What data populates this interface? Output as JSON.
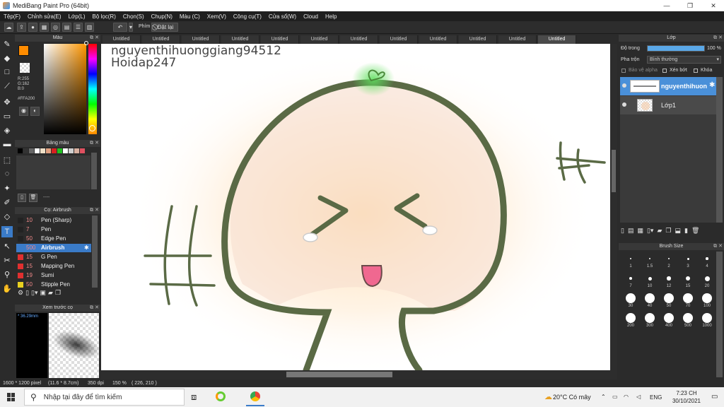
{
  "window": {
    "title": "MediBang Paint Pro (64bit)",
    "controls": [
      "—",
      "❐",
      "✕"
    ]
  },
  "menu": [
    "Tệp(F)",
    "Chỉnh sửa(E)",
    "Lớp(L)",
    "Bộ lọc(R)",
    "Chọn(S)",
    "Chụp(N)",
    "Màu (C)",
    "Xem(V)",
    "Công cụ(T)",
    "Cửa sổ(W)",
    "Cloud",
    "Help"
  ],
  "toolbar": {
    "key_label": "Phím",
    "reset_label": "Đặt lại"
  },
  "tabs": [
    "Untitled",
    "Untitled",
    "Untitled",
    "Untitled",
    "Untitled",
    "Untitled",
    "Untitled",
    "Untitled",
    "Untitled",
    "Untitled",
    "Untitled",
    "Untitled"
  ],
  "color_panel": {
    "title": "Màu",
    "foreground": "#FF8C00",
    "r": "R:255",
    "g": "G:162",
    "b": "B:0",
    "hex": "#FFA200"
  },
  "palette_panel": {
    "title": "Bảng màu",
    "colors": [
      "#000000",
      "#333333",
      "#666666",
      "#ffffff",
      "#f0e0c8",
      "#e0a080",
      "#d82020",
      "#20c020",
      "#ffffff",
      "#d0d0d0",
      "#d8b0a0",
      "#e05060"
    ],
    "name": "----"
  },
  "brush_panel": {
    "title": "Cọ: Airbrush",
    "items": [
      {
        "size": "10",
        "name": "Pen (Sharp)",
        "color": "#222222"
      },
      {
        "size": "7",
        "name": "Pen",
        "color": "#222222"
      },
      {
        "size": "50",
        "name": "Edge Pen",
        "color": "#222222"
      },
      {
        "size": "500",
        "name": "Airbrush",
        "color": "#3a7bc8"
      },
      {
        "size": "15",
        "name": "G Pen",
        "color": "#e03030"
      },
      {
        "size": "15",
        "name": "Mapping Pen",
        "color": "#e03030"
      },
      {
        "size": "19",
        "name": "Sumi",
        "color": "#e03030"
      },
      {
        "size": "50",
        "name": "Stipple Pen",
        "color": "#e8d020"
      }
    ]
  },
  "preview_panel": {
    "title": "Xem trước cọ",
    "size": "36.29mm"
  },
  "canvas": {
    "line1": "nguyenthihuonggiang94512",
    "line2": "Hoidap247"
  },
  "layer_panel": {
    "title": "Lớp",
    "opacity_label": "Độ trong",
    "opacity_value": "100 %",
    "opacity": 1.0,
    "blend_label": "Pha trộn",
    "blend_value": "Bình thường",
    "protect_alpha": "Bảo vệ alpha",
    "clipping": "Xén bớt",
    "lock": "Khóa",
    "layers": [
      {
        "name": "nguyenthihuon",
        "active": true
      },
      {
        "name": "Lớp1",
        "active": false
      }
    ]
  },
  "brushsize_panel": {
    "title": "Brush Size",
    "sizes": [
      "1",
      "1.5",
      "2",
      "3",
      "4",
      "7",
      "10",
      "12",
      "15",
      "20",
      "30",
      "40",
      "50",
      "70",
      "100",
      "200",
      "300",
      "400",
      "500",
      "1000"
    ]
  },
  "status": {
    "dimensions": "1600 * 1200 pixel",
    "cm": "(11.6 * 8.7cm)",
    "dpi": "350 dpi",
    "zoom": "150 %",
    "coords": "( 226, 210 )"
  },
  "taskbar": {
    "search_placeholder": "Nhập tại đây để tìm kiếm",
    "weather": "20°C  Có mây",
    "lang": "ENG",
    "time": "7:23 CH",
    "date": "30/10/2021"
  }
}
